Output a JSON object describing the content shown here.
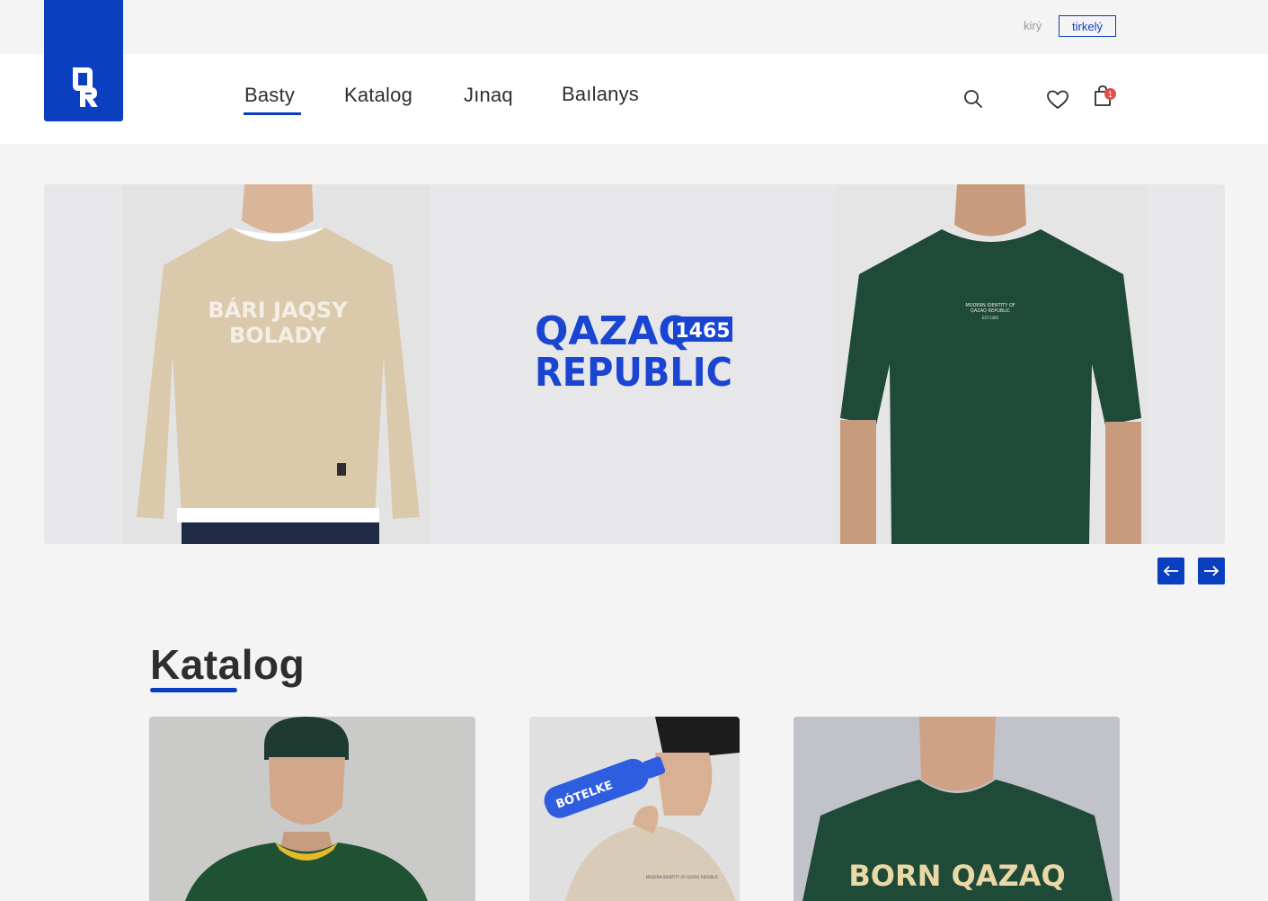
{
  "header": {
    "login_label": "kirý",
    "register_label": "tirkelý",
    "logo_icon": "qr-logo-icon",
    "nav": [
      {
        "label": "Basty",
        "active": true
      },
      {
        "label": "Katalog",
        "active": false
      },
      {
        "label": "Jınaq",
        "active": false
      },
      {
        "label": "Baılanys",
        "active": false
      }
    ],
    "icons": {
      "search": "search-icon",
      "favorites": "heart-icon",
      "cart": "shopping-bag-icon"
    },
    "cart_count": "1"
  },
  "hero": {
    "brand_line1": "QAZAQ",
    "brand_year": "1465",
    "brand_line2": "REPUBLIC",
    "left_print": [
      "BÁRI JAQSY",
      "BOLADY"
    ],
    "right_print": [
      "MODERN IDENTITY OF",
      "QAZAQ REPUBLIC",
      "EST.1465"
    ],
    "prev_icon": "arrow-left-icon",
    "next_icon": "arrow-right-icon"
  },
  "catalog": {
    "title": "Katalog",
    "cards": [
      {
        "name": "card-sweatshirt",
        "print": ""
      },
      {
        "name": "card-bottle",
        "print": "BÓTELKE",
        "tee_print": "MODERN IDENTITY OF QAZAQ REPUBLIC"
      },
      {
        "name": "card-tshirt",
        "print": "BORN QAZAQ"
      }
    ]
  },
  "colors": {
    "brand_blue": "#0a3fbf",
    "badge_red": "#e84a4a",
    "page_bg": "#f4f4f4"
  }
}
